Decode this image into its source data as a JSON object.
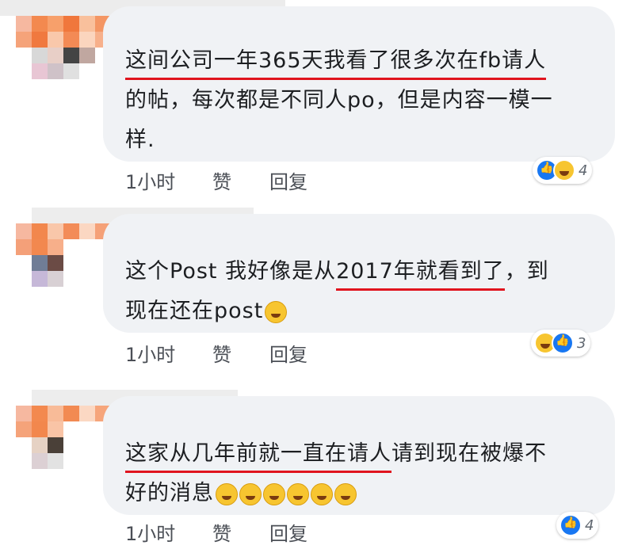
{
  "comments": [
    {
      "lines": [
        {
          "highlight": "这间公司一年365天我看了很多次在fb请人",
          "rest": ""
        },
        {
          "highlight": "",
          "rest": "的帖，每次都是不同人po，但是内容一模一"
        },
        {
          "highlight": "",
          "rest": "样."
        }
      ],
      "time": "1小时",
      "like": "赞",
      "reply": "回复",
      "reaction_count": "4"
    },
    {
      "lines": [
        {
          "pre": "这个Post 我好像是从",
          "highlight": "2017年就看到了",
          "rest": "，到"
        },
        {
          "pre": "",
          "highlight": "",
          "rest": "现在还在post"
        }
      ],
      "time": "1小时",
      "like": "赞",
      "reply": "回复",
      "reaction_count": "3"
    },
    {
      "lines": [
        {
          "highlight": "这家从几年前就一直在请人",
          "rest": "请到现在被爆不"
        },
        {
          "highlight": "",
          "rest": "好的消息"
        }
      ],
      "time": "1小时",
      "like": "赞",
      "reply": "回复",
      "reaction_count": "4"
    }
  ],
  "colors": {
    "bubble": "#f0f2f5",
    "underline": "#e0141e",
    "like_blue": "#1877f2",
    "emoji_yellow": "#f7c530"
  }
}
